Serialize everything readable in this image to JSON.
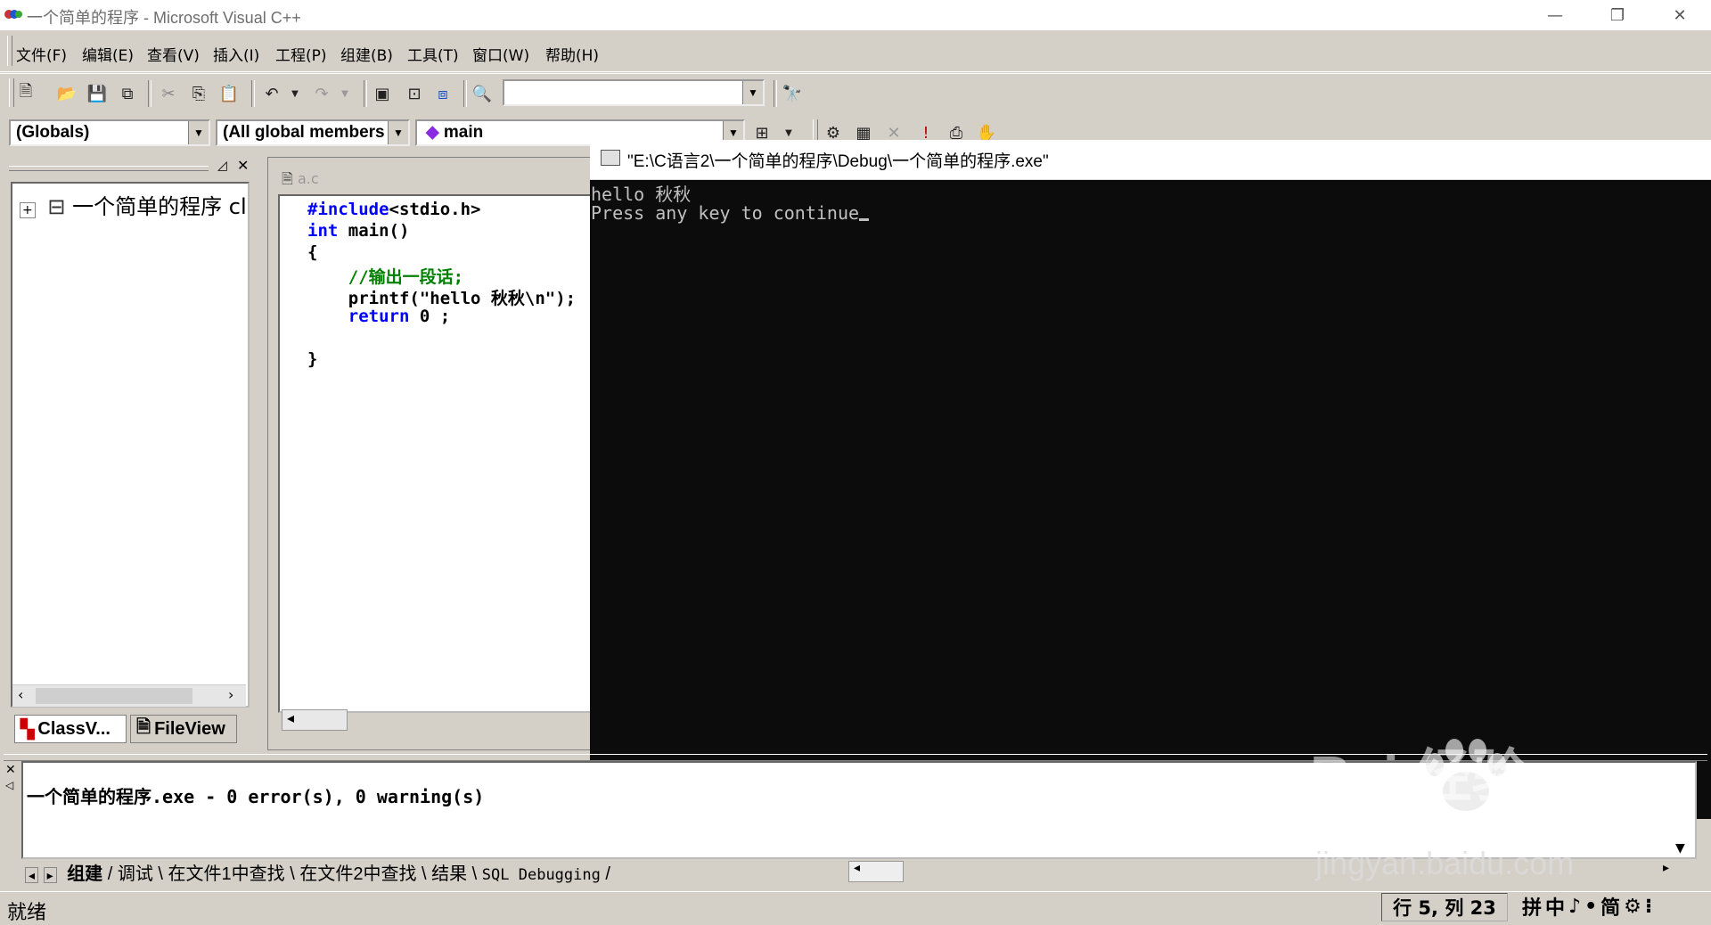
{
  "window": {
    "title": "一个简单的程序 - Microsoft Visual C++",
    "minimize_glyph": "—",
    "restore_glyph": "❐",
    "close_glyph": "✕"
  },
  "menu": [
    "文件(F)",
    "编辑(E)",
    "查看(V)",
    "插入(I)",
    "工程(P)",
    "组建(B)",
    "工具(T)",
    "窗口(W)",
    "帮助(H)"
  ],
  "toolbar": {
    "find_combo_value": "",
    "icons": [
      "new-file-icon",
      "open-folder-icon",
      "save-icon",
      "save-all-icon",
      "cut-icon",
      "copy-icon",
      "paste-icon",
      "undo-icon",
      "redo-icon",
      "workspace-icon",
      "output-icon",
      "window-list-icon",
      "find-in-files-icon",
      "find-icon"
    ]
  },
  "wizardbar": {
    "class_combo": "(Globals)",
    "filter_combo": "(All global members",
    "member_combo": "main"
  },
  "workspace": {
    "tree_item": "一个简单的程序 cl",
    "tab_classview": "ClassV...",
    "tab_fileview": "FileView"
  },
  "editor": {
    "tab_label": "a.c",
    "lines": {
      "l1_kw": "#include",
      "l1_rest": "<stdio.h>",
      "l2_kw": "int",
      "l2_rest": " main()",
      "l3": "{",
      "l4_comment": "    //输出一段话;",
      "l5": "    printf(\"hello 秋秋\\n\");",
      "l6_kw": "    return",
      "l6_rest": " 0 ;",
      "l7": "}"
    }
  },
  "console": {
    "title": "\"E:\\C语言2\\一个简单的程序\\Debug\\一个简单的程序.exe\"",
    "line1": "hello 秋秋",
    "line2": "Press any key to continue"
  },
  "output": {
    "message": "一个简单的程序.exe - 0 error(s), 0 warning(s)",
    "tabs": [
      "组建",
      "调试",
      "在文件1中查找",
      "在文件2中查找",
      "结果",
      "SQL Debugging"
    ]
  },
  "status": {
    "ready": "就绪",
    "position": "行 5, 列 23",
    "ime": [
      "拼",
      "中",
      "♪",
      "•",
      "简",
      "⚙",
      "⁝"
    ]
  },
  "watermark": {
    "brand": "Bai  经验",
    "url": "jingyan.baidu.com"
  }
}
